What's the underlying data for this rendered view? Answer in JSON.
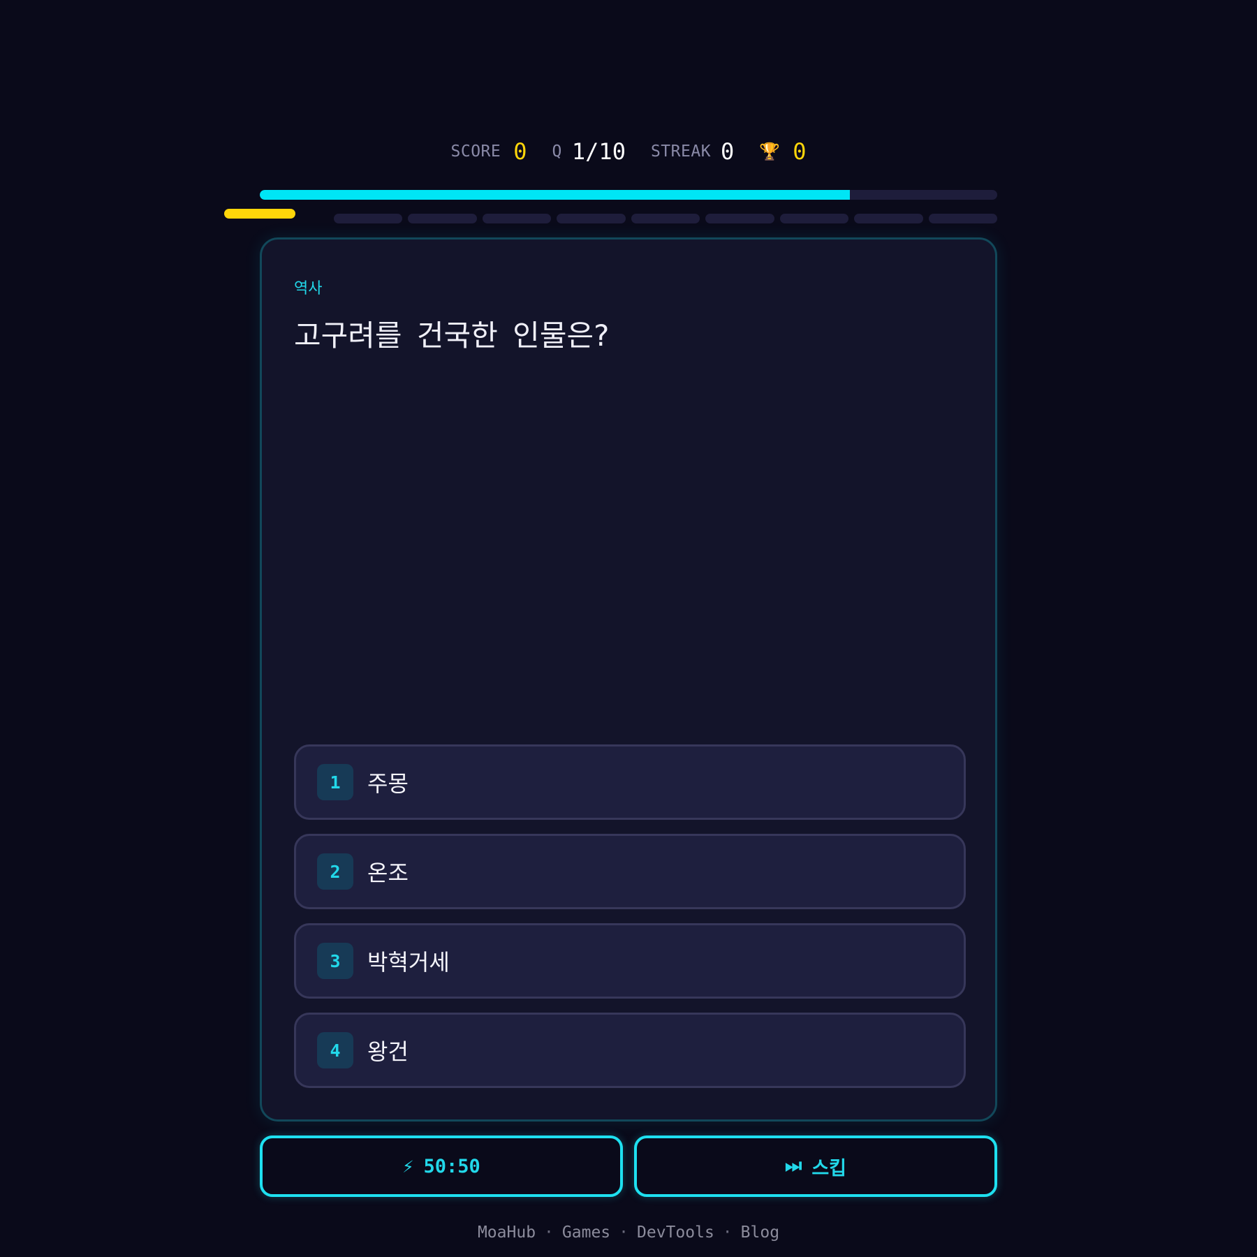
{
  "stats": {
    "score_label": "SCORE",
    "score_value": "0",
    "question_label": "Q",
    "question_value": "1/10",
    "streak_label": "STREAK",
    "streak_value": "0",
    "trophy_icon": "trophy-icon",
    "best_value": "0"
  },
  "timer": {
    "remaining_fraction": 0.8
  },
  "progress": {
    "current": 1,
    "total": 10
  },
  "question": {
    "category": "역사",
    "text": "고구려를 건국한 인물은?"
  },
  "options": [
    {
      "num": "1",
      "text": "주몽"
    },
    {
      "num": "2",
      "text": "온조"
    },
    {
      "num": "3",
      "text": "박혁거세"
    },
    {
      "num": "4",
      "text": "왕건"
    }
  ],
  "lifelines": {
    "fifty_icon": "⚡",
    "fifty_label": "50:50",
    "skip_icon": "⏭",
    "skip_label": "스킵"
  },
  "footer": {
    "links": [
      "MoaHub",
      "Games",
      "DevTools",
      "Blog"
    ],
    "separator": "·"
  },
  "colors": {
    "accent": "#00e5f5",
    "highlight": "#ffd60a",
    "background": "#0a0a1a",
    "card": "#13142a"
  }
}
